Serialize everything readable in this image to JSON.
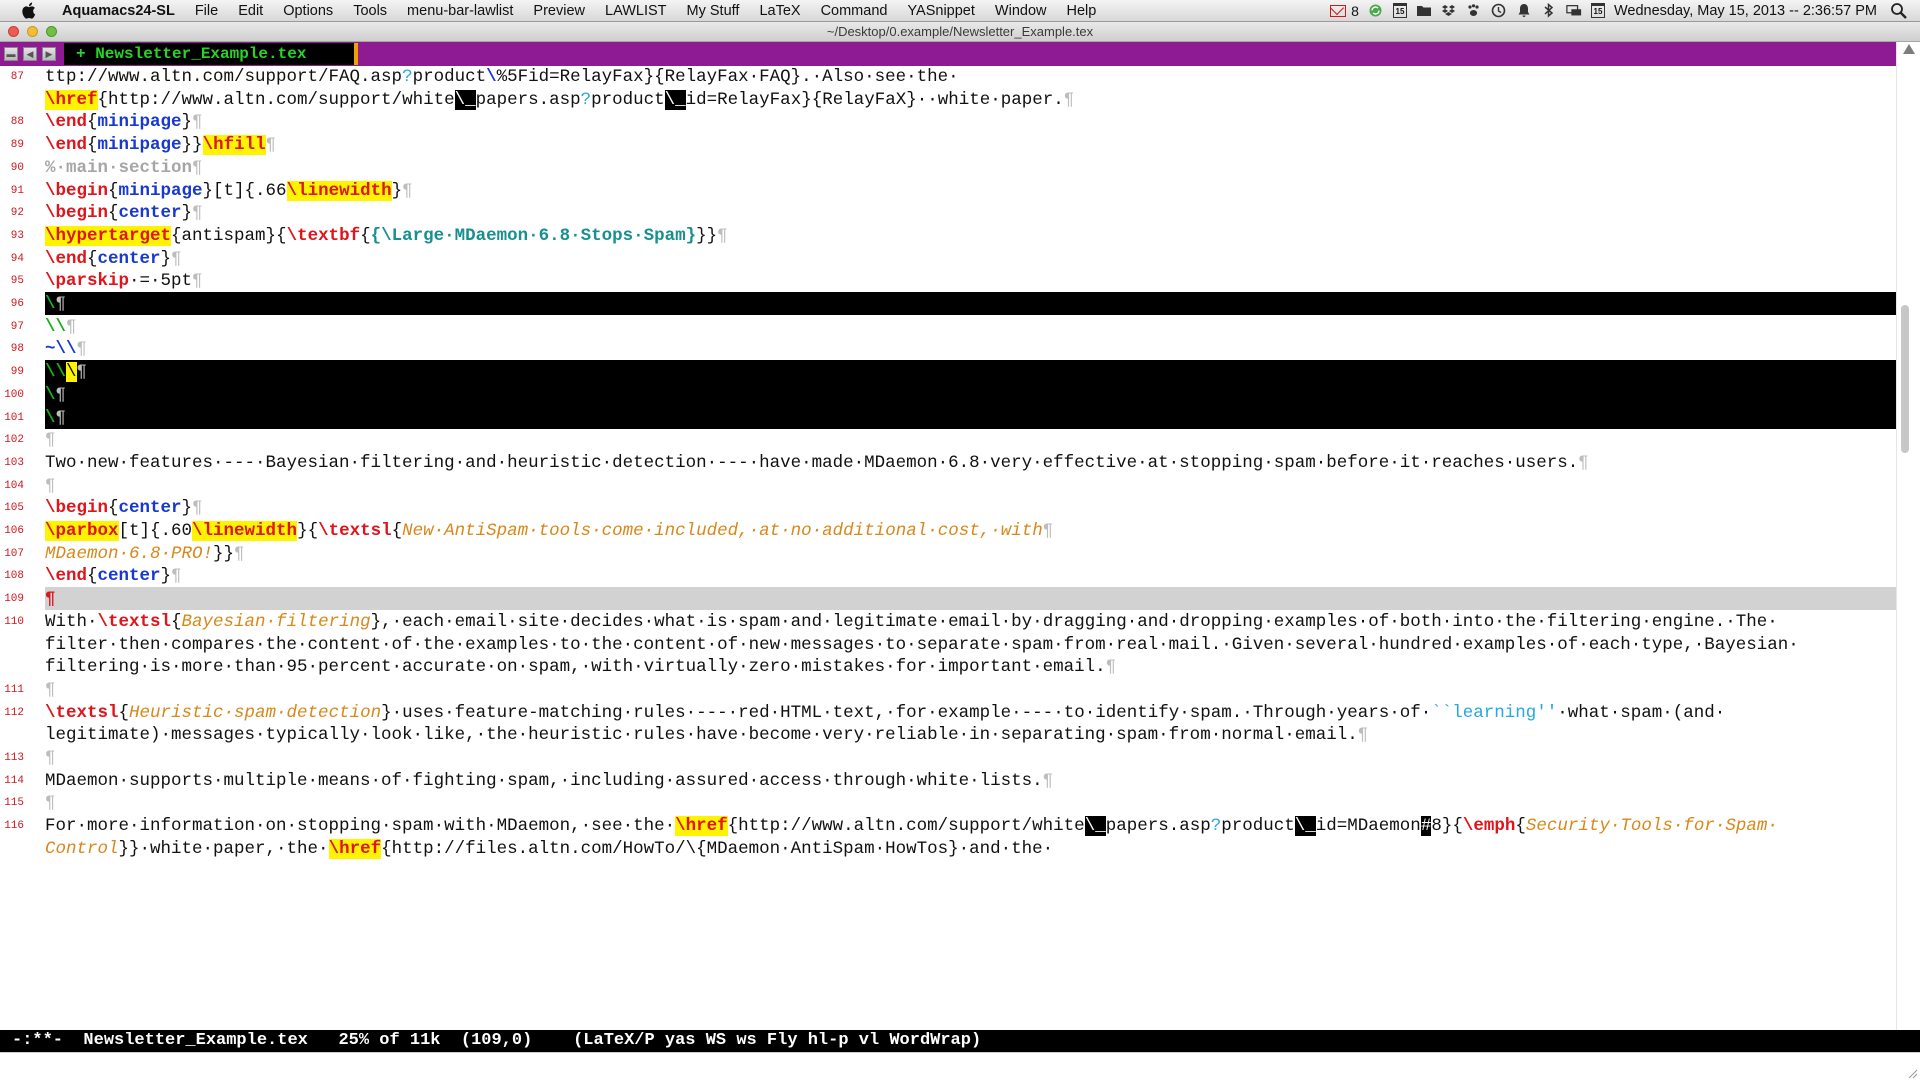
{
  "menubar": {
    "app_name": "Aquamacs24-SL",
    "items": [
      "File",
      "Edit",
      "Options",
      "Tools",
      "menu-bar-lawlist",
      "Preview",
      "LAWLIST",
      "My Stuff",
      "LaTeX",
      "Command",
      "YASnippet",
      "Window",
      "Help"
    ],
    "mail_count": "8",
    "cal_number_1": "15",
    "cal_number_2": "15",
    "clock": "Wednesday, May 15, 2013 -- 2:36:57 PM"
  },
  "window": {
    "title": "~/Desktop/0.example/Newsletter_Example.tex"
  },
  "tabbar": {
    "nav_buttons": [
      "▬",
      "◀",
      "▶"
    ],
    "tab_label": "+ Newsletter_Example.tex"
  },
  "editor": {
    "lines": [
      {
        "n": "87",
        "segs": [
          [
            "ttp://www.altn.com/support/FAQ.asp",
            ""
          ],
          [
            "?",
            "c-cyan"
          ],
          [
            "product",
            ""
          ],
          [
            "\\",
            "c-blue"
          ],
          [
            "%5Fid=RelayFax}{RelayFax·FAQ}.·Also·see·the·",
            ""
          ]
        ]
      },
      {
        "n": "",
        "segs": [
          [
            "\\href",
            "c-red hl"
          ],
          [
            "{http://www.altn.com/support/white",
            ""
          ],
          [
            "\\_",
            "blk"
          ],
          [
            "papers.asp",
            ""
          ],
          [
            "?",
            "c-cyan"
          ],
          [
            "product",
            ""
          ],
          [
            "\\_",
            "blk"
          ],
          [
            "id=RelayFax}{RelayFaX}··white·paper.",
            ""
          ],
          [
            "¶",
            "pil"
          ]
        ]
      },
      {
        "n": "88",
        "segs": [
          [
            "\\end",
            "c-red"
          ],
          [
            "{",
            ""
          ],
          [
            "minipage",
            "c-blue"
          ],
          [
            "}",
            ""
          ],
          [
            "¶",
            "pil"
          ]
        ]
      },
      {
        "n": "89",
        "segs": [
          [
            "\\end",
            "c-red"
          ],
          [
            "{",
            ""
          ],
          [
            "minipage",
            "c-blue"
          ],
          [
            "}}",
            ""
          ],
          [
            "\\hfill",
            "c-red hl"
          ],
          [
            "¶",
            "pil"
          ]
        ]
      },
      {
        "n": "90",
        "segs": [
          [
            "%·main·section",
            "c-gray"
          ],
          [
            "¶",
            "pil"
          ]
        ]
      },
      {
        "n": "91",
        "segs": [
          [
            "\\begin",
            "c-red"
          ],
          [
            "{",
            ""
          ],
          [
            "minipage",
            "c-blue"
          ],
          [
            "}[t]{.66",
            ""
          ],
          [
            "\\linewidth",
            "c-red hl"
          ],
          [
            "}",
            ""
          ],
          [
            "¶",
            "pil"
          ]
        ]
      },
      {
        "n": "92",
        "segs": [
          [
            "\\begin",
            "c-red"
          ],
          [
            "{",
            ""
          ],
          [
            "center",
            "c-blue"
          ],
          [
            "}",
            ""
          ],
          [
            "¶",
            "pil"
          ]
        ]
      },
      {
        "n": "93",
        "segs": [
          [
            "\\hypertarget",
            "c-red hl"
          ],
          [
            "{antispam}{",
            ""
          ],
          [
            "\\textbf",
            "c-red"
          ],
          [
            "{",
            ""
          ],
          [
            "{\\Large·MDaemon·6.8·Stops·Spam}",
            "c-teal"
          ],
          [
            "}}",
            ""
          ],
          [
            "¶",
            "pil"
          ]
        ]
      },
      {
        "n": "94",
        "segs": [
          [
            "\\end",
            "c-red"
          ],
          [
            "{",
            ""
          ],
          [
            "center",
            "c-blue"
          ],
          [
            "}",
            ""
          ],
          [
            "¶",
            "pil"
          ]
        ]
      },
      {
        "n": "95",
        "segs": [
          [
            "\\parskip",
            "c-red"
          ],
          [
            "·=·5pt",
            ""
          ],
          [
            "¶",
            "pil"
          ]
        ]
      },
      {
        "n": "96",
        "black": true,
        "segs": [
          [
            "\\",
            "c-green"
          ],
          [
            "¶",
            "pil"
          ]
        ]
      },
      {
        "n": "97",
        "segs": [
          [
            "\\\\",
            "c-green"
          ],
          [
            "¶",
            "pil"
          ]
        ]
      },
      {
        "n": "98",
        "segs": [
          [
            "~\\\\",
            "c-blue"
          ],
          [
            "¶",
            "pil"
          ]
        ]
      },
      {
        "n": "99",
        "black": true,
        "segs": [
          [
            "\\\\",
            "c-green"
          ],
          [
            "\\",
            "hl"
          ],
          [
            "¶",
            "pil"
          ]
        ]
      },
      {
        "n": "100",
        "black": true,
        "segs": [
          [
            "\\",
            "c-green"
          ],
          [
            "¶",
            "pil"
          ]
        ]
      },
      {
        "n": "101",
        "black": true,
        "segs": [
          [
            "\\",
            "c-green"
          ],
          [
            "¶",
            "pil"
          ]
        ]
      },
      {
        "n": "102",
        "segs": [
          [
            "¶",
            "pil"
          ]
        ]
      },
      {
        "n": "103",
        "segs": [
          [
            "Two·new·features·---·Bayesian·filtering·and·heuristic·detection·---·have·made·MDaemon·6.8·very·effective·at·stopping·spam·before·it·reaches·users.",
            ""
          ],
          [
            "¶",
            "pil"
          ]
        ]
      },
      {
        "n": "104",
        "segs": [
          [
            "¶",
            "pil"
          ]
        ]
      },
      {
        "n": "105",
        "segs": [
          [
            "\\begin",
            "c-red"
          ],
          [
            "{",
            ""
          ],
          [
            "center",
            "c-blue"
          ],
          [
            "}",
            ""
          ],
          [
            "¶",
            "pil"
          ]
        ]
      },
      {
        "n": "106",
        "segs": [
          [
            "\\parbox",
            "c-red hl"
          ],
          [
            "[t]{.60",
            ""
          ],
          [
            "\\linewidth",
            "c-red hl"
          ],
          [
            "}{",
            ""
          ],
          [
            "\\textsl",
            "c-red"
          ],
          [
            "{",
            ""
          ],
          [
            "New·AntiSpam·tools·come·included,·at·no·additional·cost,·with",
            "c-orange"
          ],
          [
            "¶",
            "pil"
          ]
        ]
      },
      {
        "n": "107",
        "segs": [
          [
            "MDaemon·6.8·PRO!",
            "c-orange"
          ],
          [
            "}}",
            ""
          ],
          [
            "¶",
            "pil"
          ]
        ]
      },
      {
        "n": "108",
        "segs": [
          [
            "\\end",
            "c-red"
          ],
          [
            "{",
            ""
          ],
          [
            "center",
            "c-blue"
          ],
          [
            "}",
            ""
          ],
          [
            "¶",
            "pil"
          ]
        ]
      },
      {
        "n": "109",
        "current": true,
        "segs": [
          [
            "¶",
            "c-red"
          ]
        ]
      },
      {
        "n": "110",
        "segs": [
          [
            "With·",
            ""
          ],
          [
            "\\textsl",
            "c-red"
          ],
          [
            "{",
            ""
          ],
          [
            "Bayesian·filtering",
            "c-orange"
          ],
          [
            "},·each·email·site·decides·what·is·spam·and·legitimate·email·by·dragging·and·dropping·examples·of·both·into·the·filtering·engine.·The·",
            ""
          ]
        ]
      },
      {
        "n": "",
        "segs": [
          [
            "filter·then·compares·the·content·of·the·examples·to·the·content·of·new·messages·to·separate·spam·from·real·mail.·Given·several·hundred·examples·of·each·type,·Bayesian·",
            ""
          ]
        ]
      },
      {
        "n": "",
        "segs": [
          [
            "filtering·is·more·than·95·percent·accurate·on·spam,·with·virtually·zero·mistakes·for·important·email.",
            ""
          ],
          [
            "¶",
            "pil"
          ]
        ]
      },
      {
        "n": "111",
        "segs": [
          [
            "¶",
            "pil"
          ]
        ]
      },
      {
        "n": "112",
        "segs": [
          [
            "\\textsl",
            "c-red"
          ],
          [
            "{",
            ""
          ],
          [
            "Heuristic·spam·detection",
            "c-orange"
          ],
          [
            "}·uses·feature-matching·rules·---·red·HTML·text,·for·example·---·to·identify·spam.·Through·years·of·",
            ""
          ],
          [
            "``learning''",
            "c-cyan"
          ],
          [
            "·what·spam·(and·",
            ""
          ]
        ]
      },
      {
        "n": "",
        "segs": [
          [
            "legitimate)·messages·typically·look·like,·the·heuristic·rules·have·become·very·reliable·in·separating·spam·from·normal·email.",
            ""
          ],
          [
            "¶",
            "pil"
          ]
        ]
      },
      {
        "n": "113",
        "segs": [
          [
            "¶",
            "pil"
          ]
        ]
      },
      {
        "n": "114",
        "segs": [
          [
            "MDaemon·supports·multiple·means·of·fighting·spam,·including·assured·access·through·white·lists.",
            ""
          ],
          [
            "¶",
            "pil"
          ]
        ]
      },
      {
        "n": "115",
        "segs": [
          [
            "¶",
            "pil"
          ]
        ]
      },
      {
        "n": "116",
        "segs": [
          [
            "For·more·information·on·stopping·spam·with·MDaemon,·see·the·",
            ""
          ],
          [
            "\\href",
            "c-red hl"
          ],
          [
            "{http://www.altn.com/support/white",
            ""
          ],
          [
            "\\_",
            "blk"
          ],
          [
            "papers.asp",
            ""
          ],
          [
            "?",
            "c-cyan"
          ],
          [
            "product",
            ""
          ],
          [
            "\\_",
            "blk"
          ],
          [
            "id=MDaemon",
            ""
          ],
          [
            "#",
            "blk"
          ],
          [
            "8}{",
            ""
          ],
          [
            "\\emph",
            "c-red"
          ],
          [
            "{",
            ""
          ],
          [
            "Security·Tools·for·Spam·",
            "c-orange"
          ]
        ]
      },
      {
        "n": "",
        "segs": [
          [
            "Control",
            "c-orange"
          ],
          [
            "}}·white·paper,·the·",
            ""
          ],
          [
            "\\href",
            "c-red hl"
          ],
          [
            "{http://files.altn.com/HowTo/\\{MDaemon·AntiSpam·HowTos}·and·the·",
            ""
          ]
        ]
      }
    ]
  },
  "modeline": {
    "text": "-:**-  Newsletter_Example.tex   25% of 11k  (109,0)    (LaTeX/P yas WS ws Fly hl-p vl WordWrap)"
  }
}
